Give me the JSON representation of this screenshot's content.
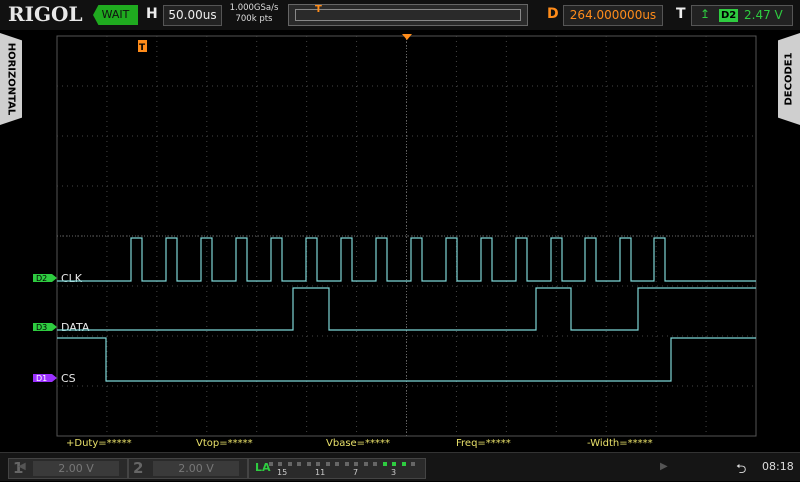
{
  "header": {
    "brand": "RIGOL",
    "run_status": "WAIT",
    "horizontal_label": "H",
    "timebase": "50.00us",
    "sample_rate": "1.000GSa/s",
    "memory_depth": "700k pts",
    "delay_label": "D",
    "delay": "264.000000us",
    "trigger_label": "T",
    "trigger_source": "D2",
    "trigger_level": "2.47 V",
    "trigger_level_color": "#2ecc40",
    "delay_color": "#ff8c1a"
  },
  "left_tab": "HORIZONTAL",
  "right_tab": "DECODE1",
  "channels": {
    "clk": {
      "tag": "D2",
      "name": "CLK",
      "color": "#2ecc40"
    },
    "data": {
      "tag": "D3",
      "name": "DATA",
      "color": "#2ecc40"
    },
    "cs": {
      "tag": "D1",
      "name": "CS",
      "color": "#9b30ff"
    }
  },
  "waveform_color": "#7ed6d6",
  "measurements": [
    "+Duty=*****",
    "Vtop=*****",
    "Vbase=*****",
    "Freq=*****",
    "-Width=*****"
  ],
  "footer": {
    "ch1_num": "1",
    "ch1_scale": "2.00 V",
    "ch2_num": "2",
    "ch2_scale": "2.00 V",
    "la_label": "LA",
    "la_numbers": [
      "15",
      "11",
      "7",
      "3"
    ],
    "la_active_channels": [
      1,
      2,
      3
    ],
    "time": "08:18",
    "usb_icon": "usb-icon"
  }
}
